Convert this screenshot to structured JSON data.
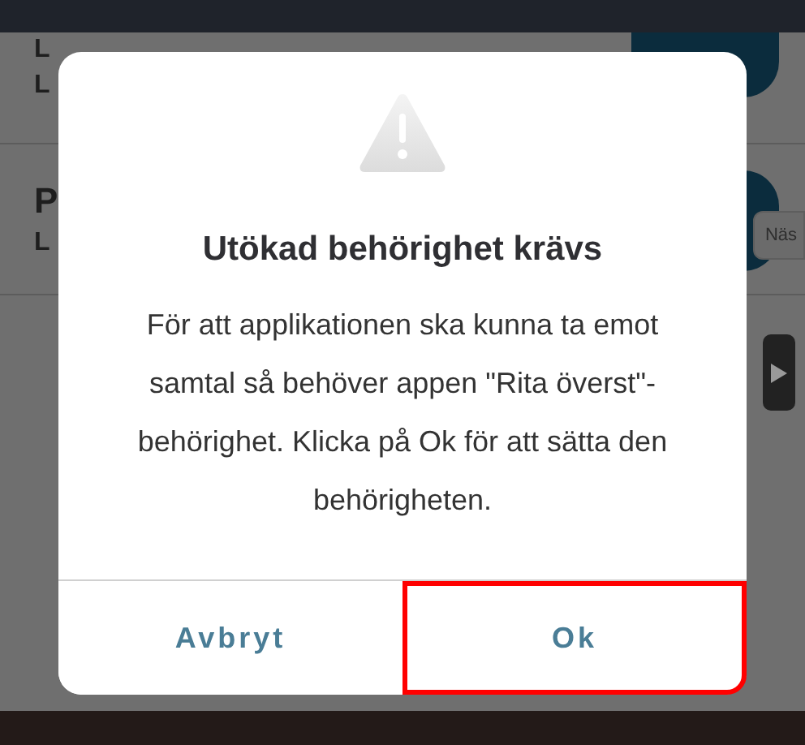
{
  "background_list": {
    "rows": [
      {
        "lines": [
          {
            "label": "L"
          },
          {
            "label": "L"
          }
        ]
      },
      {
        "title": "P",
        "lines": [
          {
            "label": "L"
          }
        ]
      }
    ],
    "side_tab": "Näs"
  },
  "dialog": {
    "title": "Utökad behörighet krävs",
    "message": "För att applikationen ska kunna ta emot samtal så behöver appen \"Rita överst\"-behörighet. Klicka på Ok för att sätta den behörigheten.",
    "buttons": [
      {
        "label": "Avbryt",
        "highlighted": false
      },
      {
        "label": "Ok",
        "highlighted": true
      }
    ]
  }
}
